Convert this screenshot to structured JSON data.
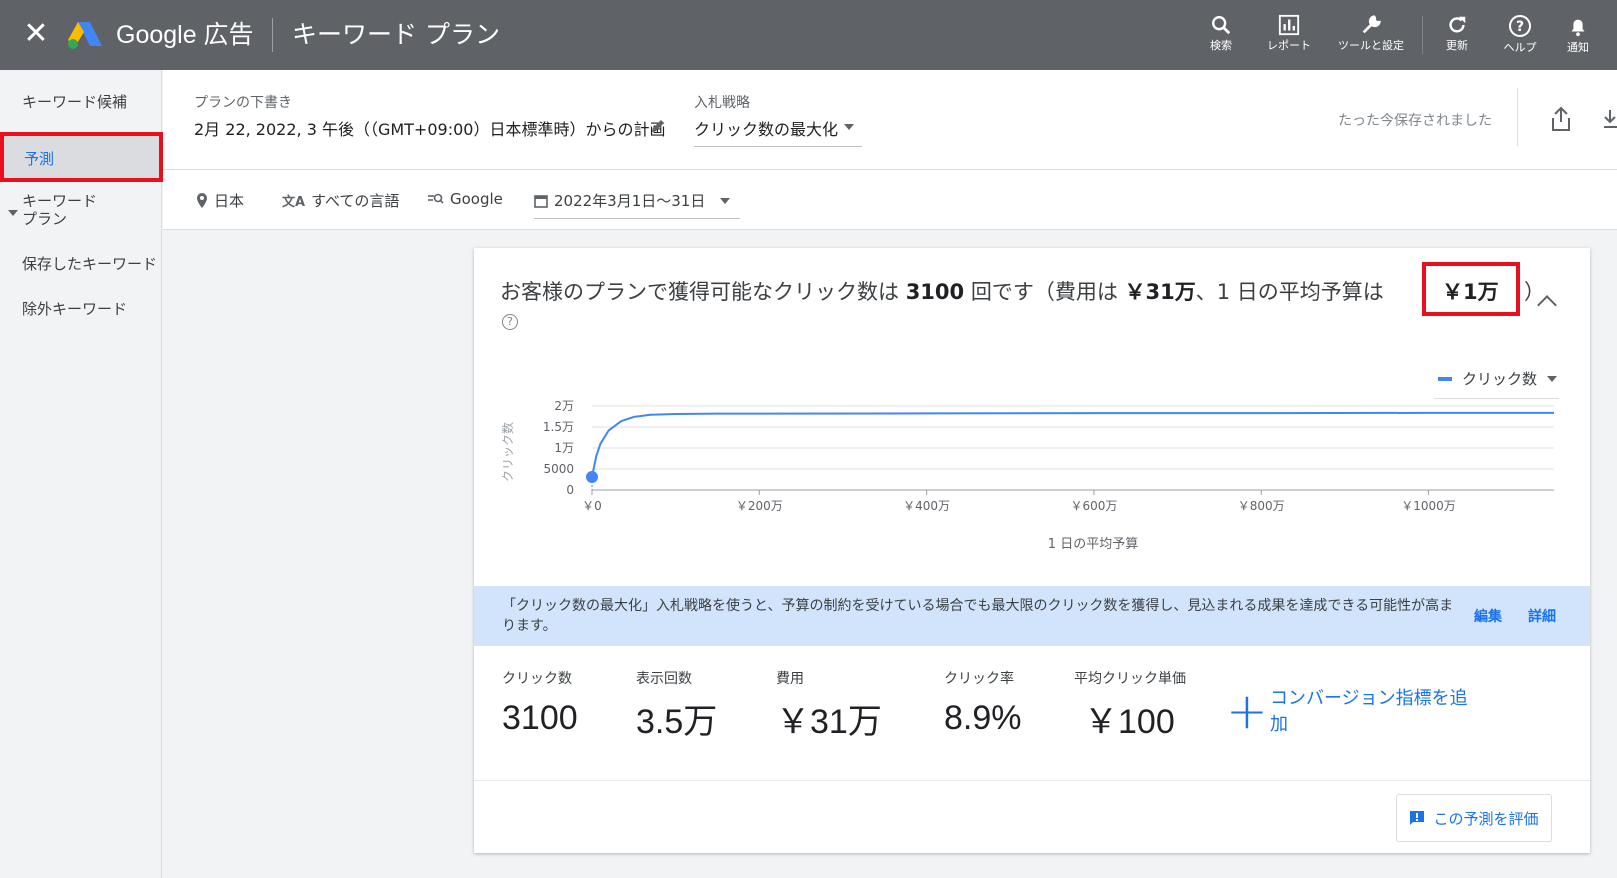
{
  "header": {
    "brand": "Google 広告",
    "page_title": "キーワード プラン",
    "icons": [
      {
        "name": "search-icon",
        "label": "検索"
      },
      {
        "name": "report-icon",
        "label": "レポート"
      },
      {
        "name": "wrench-icon",
        "label": "ツールと設定"
      },
      {
        "name": "refresh-icon",
        "label": "更新"
      },
      {
        "name": "help-icon",
        "label": "ヘルプ"
      },
      {
        "name": "bell-icon",
        "label": "通知"
      }
    ]
  },
  "sidebar": {
    "items": [
      {
        "label": "キーワード候補"
      },
      {
        "label": "予測"
      },
      {
        "label": "キーワード\nプラン"
      },
      {
        "label": "保存したキーワード"
      },
      {
        "label": "除外キーワード"
      }
    ]
  },
  "plan": {
    "draft_label": "プランの下書き",
    "draft_value": "2月 22, 2022, 3 午後（（GMT+09:00）日本標準時）からの計画",
    "bid_label": "入札戦略",
    "bid_value": "クリック数の最大化",
    "saved_status": "たった今保存されました"
  },
  "filters": {
    "location": "日本",
    "language": "すべての言語",
    "network": "Google",
    "date_range": "2022年3月1日〜31日"
  },
  "forecast": {
    "headline_pre": "お客様のプランで獲得可能なクリック数は",
    "clicks_bold": "3100",
    "headline_mid1": "回です（費用は",
    "cost_bold": "￥31万",
    "headline_mid2": "、1 日の平均予算は",
    "budget_bold": "￥1万",
    "headline_end": "）",
    "legend_label": "クリック数",
    "info_text": "「クリック数の最大化」入札戦略を使うと、予算の制約を受けている場合でも最大限のクリック数を獲得し、見込まれる成果を達成できる可能性が高まります。",
    "edit_link": "編集",
    "details_link": "詳細",
    "metrics": [
      {
        "label": "クリック数",
        "value": "3100"
      },
      {
        "label": "表示回数",
        "value": "3.5万"
      },
      {
        "label": "費用",
        "value": "￥31万"
      },
      {
        "label": "クリック率",
        "value": "8.9%"
      },
      {
        "label": "平均クリック単価",
        "value": "￥100"
      }
    ],
    "add_conversion": "コンバージョン指標を追加",
    "rate_button": "この予測を評価"
  },
  "colors": {
    "accent": "#1a73e8",
    "highlight": "#e8101c",
    "series": "#4285f4"
  },
  "chart_data": {
    "type": "line",
    "xlabel": "1 日の平均予算",
    "ylabel": "クリック数",
    "x_tick_labels": [
      "￥0",
      "￥200万",
      "￥400万",
      "￥600万",
      "￥800万",
      "￥1000万"
    ],
    "y_tick_labels": [
      "0",
      "5000",
      "1万",
      "1.5万",
      "2万"
    ],
    "x_ticks": [
      0,
      2000000,
      4000000,
      6000000,
      8000000,
      10000000
    ],
    "y_ticks": [
      0,
      5000,
      10000,
      15000,
      20000
    ],
    "xlim": [
      0,
      11500000
    ],
    "ylim": [
      0,
      20000
    ],
    "series": [
      {
        "name": "クリック数",
        "x": [
          0,
          50000,
          100000,
          200000,
          350000,
          500000,
          700000,
          1000000,
          1500000,
          2000000,
          4000000,
          6000000,
          8000000,
          10000000,
          11500000
        ],
        "y": [
          3100,
          8000,
          11000,
          14200,
          16400,
          17400,
          17900,
          18100,
          18200,
          18200,
          18250,
          18300,
          18300,
          18350,
          18350
        ]
      }
    ],
    "highlight_point": {
      "x": 0,
      "y": 3100
    },
    "grid": true
  }
}
